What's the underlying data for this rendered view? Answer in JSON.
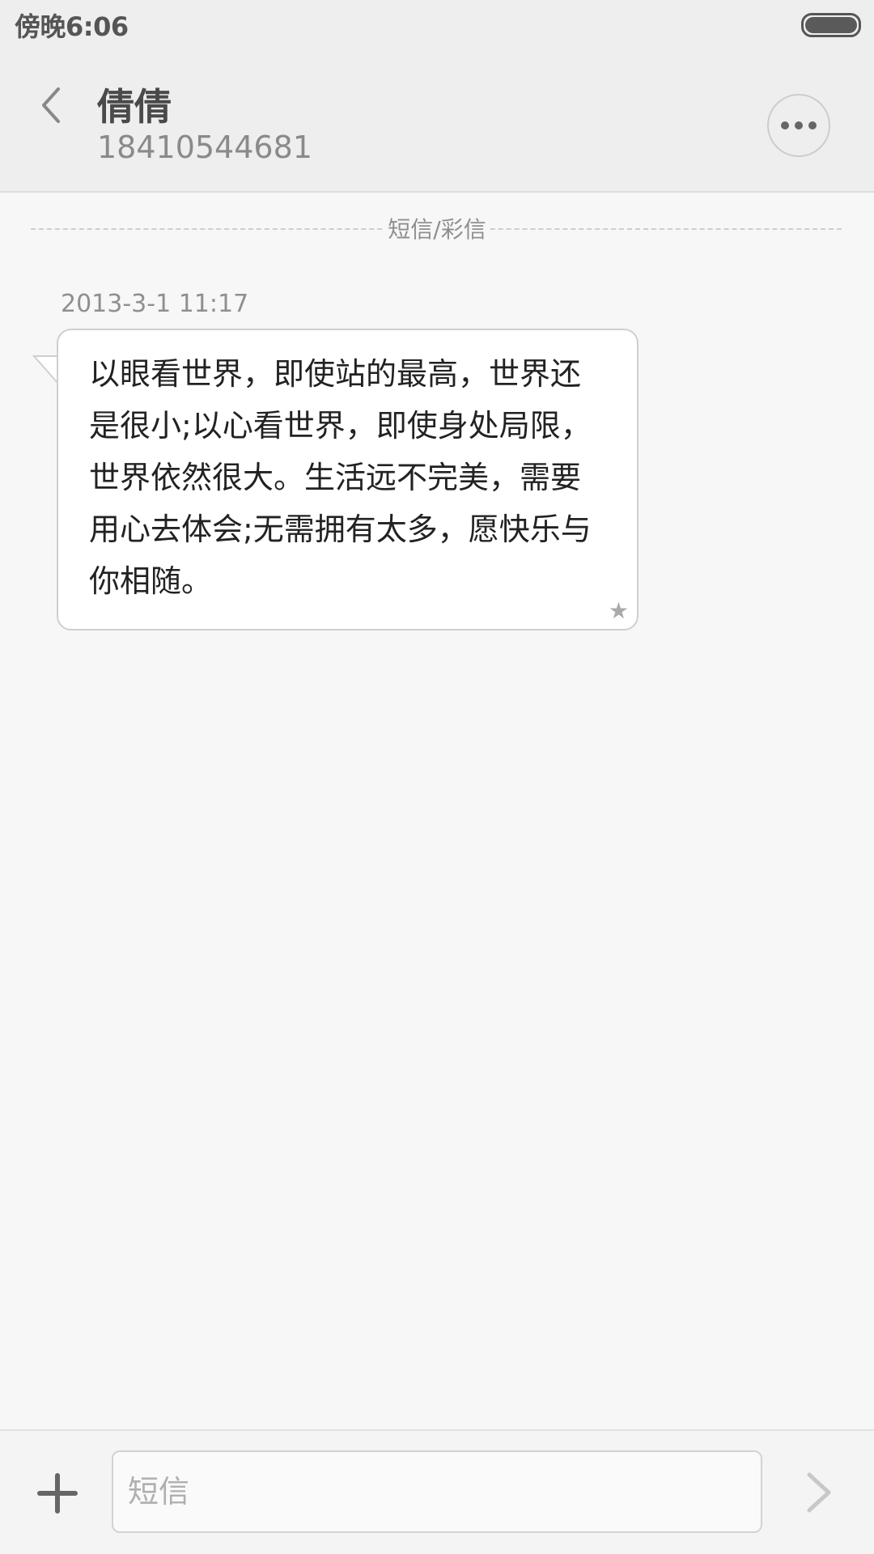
{
  "status_bar": {
    "time": "傍晚6:06",
    "battery_icon": "battery-full-icon"
  },
  "header": {
    "back_icon": "chevron-left-icon",
    "contact_name": "倩倩",
    "contact_number": "18410544681",
    "more_icon": "more-dots-icon"
  },
  "thread": {
    "channel_label": "短信/彩信",
    "messages": [
      {
        "timestamp": "2013-3-1 11:17",
        "text": "以眼看世界，即使站的最高，世界还是很小;以心看世界，即使身处局限，世界依然很大。生活远不完美，需要用心去体会;无需拥有太多，愿快乐与你相随。",
        "starred": true,
        "star_glyph": "★"
      }
    ]
  },
  "composer": {
    "add_icon": "plus-icon",
    "placeholder": "短信",
    "value": "",
    "send_icon": "send-arrow-icon"
  },
  "colors": {
    "background": "#f7f7f7",
    "header_bg": "#eeeeee",
    "bubble_bg": "#ffffff",
    "secondary_text": "#8f8f8f"
  }
}
